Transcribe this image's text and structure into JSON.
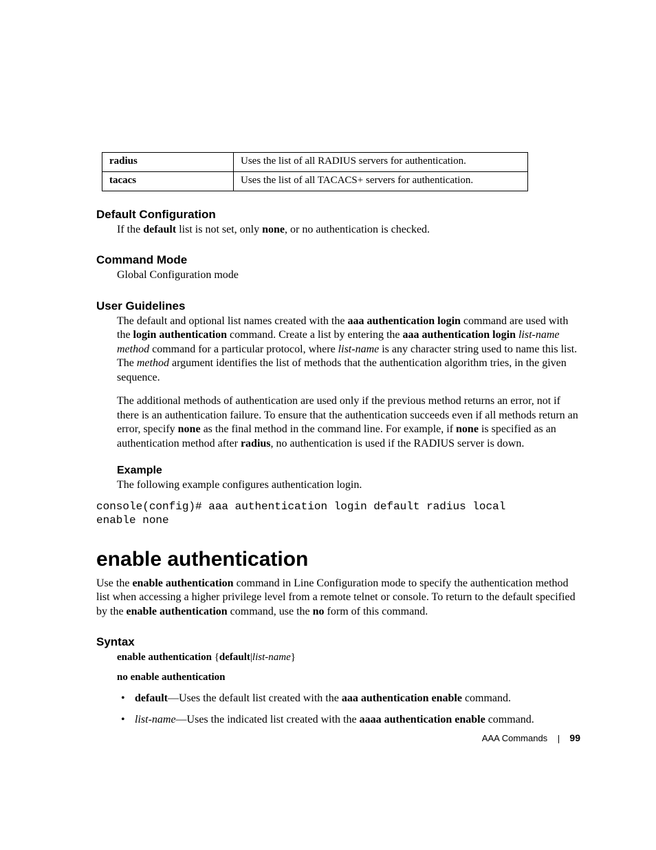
{
  "table": {
    "rows": [
      {
        "key": "radius",
        "desc": "Uses the list of all RADIUS servers for authentication."
      },
      {
        "key": "tacacs",
        "desc": "Uses the list of all TACACS+ servers for authentication."
      }
    ]
  },
  "defaultConfig": {
    "heading": "Default Configuration",
    "p_a": "If the ",
    "p_b": "default",
    "p_c": " list is not set, only ",
    "p_d": "none",
    "p_e": ", or no authentication is checked."
  },
  "commandMode": {
    "heading": "Command Mode",
    "p": "Global Configuration mode"
  },
  "userGuidelines": {
    "heading": "User Guidelines",
    "p1_a": "The default and optional list names created with the ",
    "p1_b": "aaa authentication login",
    "p1_c": " command are used with the ",
    "p1_d": "login authentication",
    "p1_e": " command. Create a list by entering the ",
    "p1_f": "aaa authentication login",
    "p1_g": " ",
    "p1_h": "list-name method",
    "p1_i": " command for a particular protocol, where ",
    "p1_j": "list-name",
    "p1_k": " is any character string used to name this list. The ",
    "p1_l": "method",
    "p1_m": " argument identifies the list of methods that the authentication algorithm tries, in the given sequence.",
    "p2_a": "The additional methods of authentication are used only if the previous method returns an error, not if there is an authentication failure. To ensure that the authentication succeeds even if all methods return an error, specify ",
    "p2_b": "none",
    "p2_c": " as the final method in the command line. For example, if ",
    "p2_d": "none",
    "p2_e": " is specified as an authentication method after ",
    "p2_f": "radius",
    "p2_g": ", no authentication is used if the RADIUS server is down."
  },
  "example": {
    "heading": "Example",
    "p": "The following example configures authentication login.",
    "code": "console(config)# aaa authentication login default radius local\nenable none"
  },
  "enableAuth": {
    "heading": "enable authentication",
    "p_a": "Use the ",
    "p_b": "enable authentication",
    "p_c": " command in Line Configuration mode to specify the authentication method list when accessing a higher privilege level from a remote telnet or console. To return to the default specified by the ",
    "p_d": "enable authentication",
    "p_e": " command, use the ",
    "p_f": "no",
    "p_g": " form of this command."
  },
  "syntax": {
    "heading": "Syntax",
    "l1_a": "enable authentication",
    "l1_b": " {",
    "l1_c": "default",
    "l1_d": "|",
    "l1_e": "list-name",
    "l1_f": "}",
    "l2": "no enable authentication",
    "b1_a": "default",
    "b1_b": "—Uses the default list created with the ",
    "b1_c": "aaa authentication enable",
    "b1_d": " command.",
    "b2_a": "list-name",
    "b2_b": "—Uses the indicated list created with the ",
    "b2_c": "aaaa authentication enable",
    "b2_d": " command."
  },
  "footer": {
    "section": "AAA Commands",
    "page": "99"
  }
}
